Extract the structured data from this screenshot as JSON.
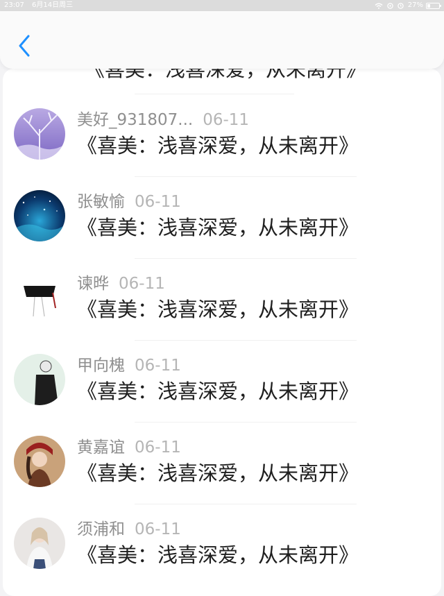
{
  "status_bar": {
    "time": "23:07",
    "date": "6月14日周三",
    "battery": "27%",
    "battery_level": 0.27
  },
  "header": {
    "back_icon": "chevron-left-icon",
    "accent_color": "#1e90ff"
  },
  "cut_row": {
    "text": "《喜美：浅喜深爱，从未离开》"
  },
  "comments": [
    {
      "username": "美好_931807...",
      "date": "06-11",
      "text": "《喜美：浅喜深爱，从未离开》"
    },
    {
      "username": "张敏愉",
      "date": "06-11",
      "text": "《喜美：浅喜深爱，从未离开》"
    },
    {
      "username": "谏晔",
      "date": "06-11",
      "text": "《喜美：浅喜深爱，从未离开》"
    },
    {
      "username": "甲向槐",
      "date": "06-11",
      "text": "《喜美：浅喜深爱，从未离开》"
    },
    {
      "username": "黄嘉谊",
      "date": "06-11",
      "text": "《喜美：浅喜深爱，从未离开》"
    },
    {
      "username": "须浦和",
      "date": "06-11",
      "text": "《喜美：浅喜深爱，从未离开》"
    }
  ]
}
